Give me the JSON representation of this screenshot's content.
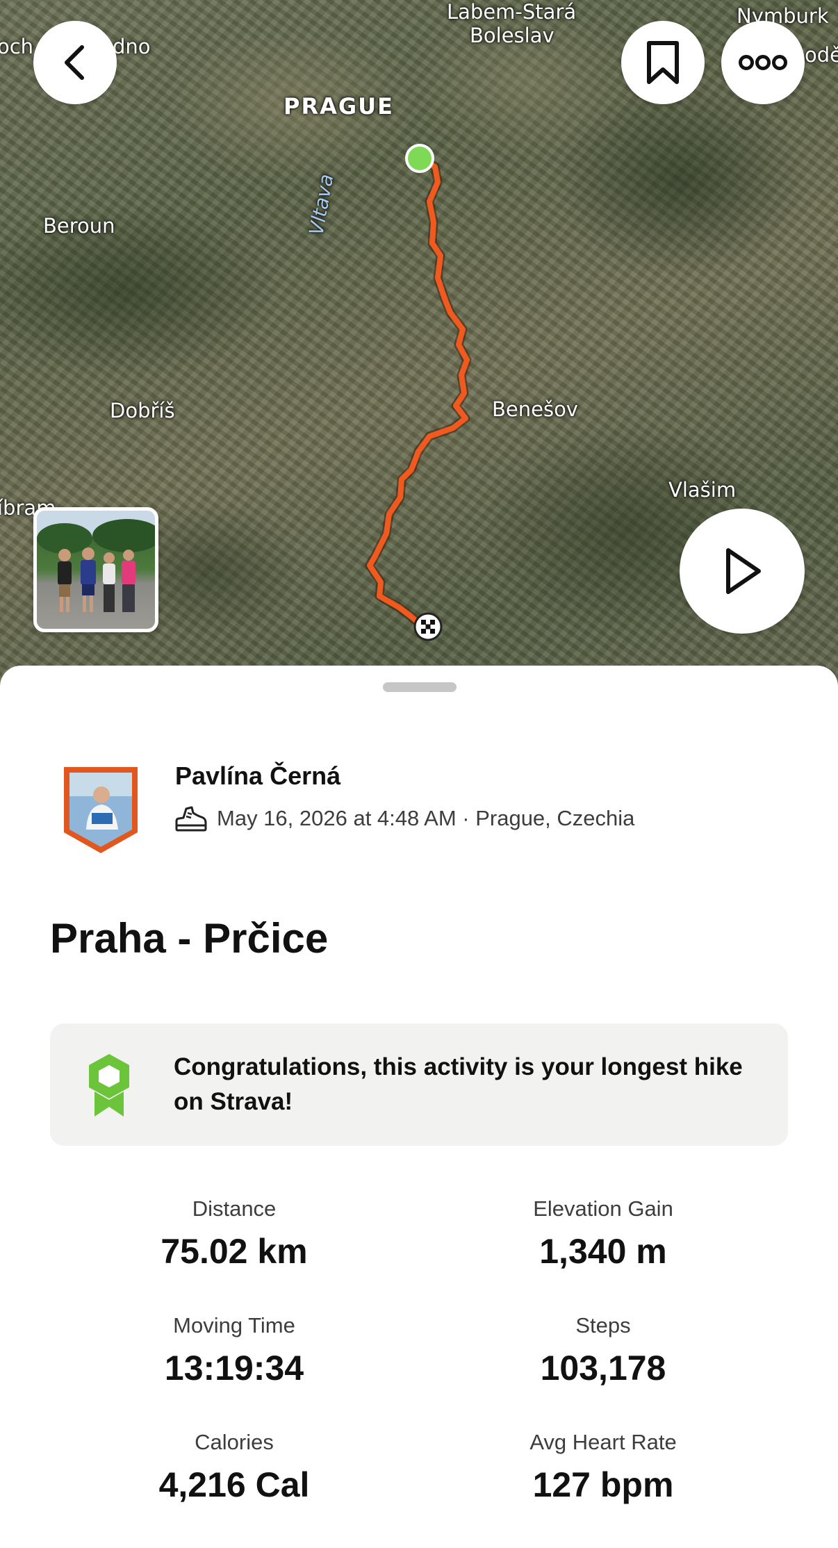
{
  "map": {
    "labels": {
      "labem": "Labem-Stará",
      "boleslav": "Boleslav",
      "nymburk": "Nymburk",
      "prague": "PRAGUE",
      "vltava": "Vltava",
      "beroun": "Beroun",
      "dobris": "Dobříš",
      "benesov": "Benešov",
      "vlasim": "Vlašim",
      "edge_top_left": "och",
      "edge_dno": "dno",
      "edge_right": "odě",
      "edge_left": "íbram"
    },
    "route_color": "#f05a1e",
    "start_color": "#7ed957"
  },
  "nav": {
    "back_icon": "chevron-left-icon",
    "bookmark_icon": "bookmark-icon",
    "more_icon": "more-horizontal-icon",
    "play_icon": "play-icon"
  },
  "athlete": {
    "name": "Pavlína Černá",
    "activity_icon": "hiking-shoe-icon",
    "meta": "May 16, 2026 at 4:48 AM · Prague, Czechia",
    "badge_color": "#e2571e"
  },
  "activity": {
    "title": "Praha - Prčice"
  },
  "achievement": {
    "icon": "medal-icon",
    "text": "Congratulations, this activity is your longest hike on Strava!",
    "icon_color": "#6bc43a"
  },
  "stats": [
    {
      "label": "Distance",
      "value": "75.02 km"
    },
    {
      "label": "Elevation Gain",
      "value": "1,340 m"
    },
    {
      "label": "Moving Time",
      "value": "13:19:34"
    },
    {
      "label": "Steps",
      "value": "103,178"
    },
    {
      "label": "Calories",
      "value": "4,216 Cal"
    },
    {
      "label": "Avg Heart Rate",
      "value": "127 bpm"
    }
  ]
}
